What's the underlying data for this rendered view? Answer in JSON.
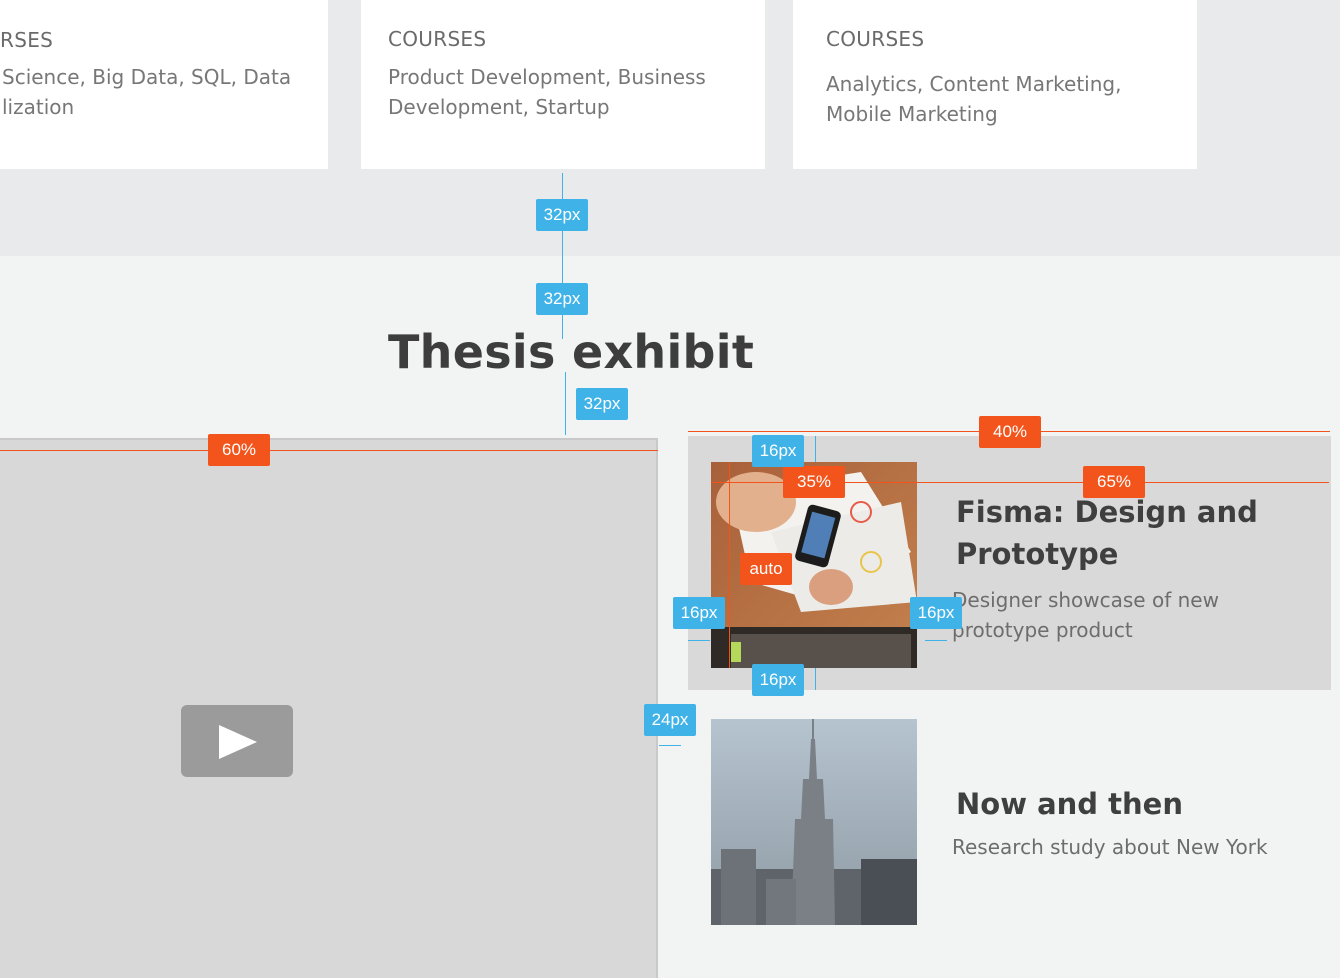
{
  "cards": [
    {
      "label": "RSES",
      "courses": "Science, Big Data, SQL, Data\nlization"
    },
    {
      "label": "COURSES",
      "courses": "Product Development, Business\nDevelopment, Startup"
    },
    {
      "label": "COURSES",
      "courses": "Analytics, Content Marketing,\nMobile Marketing"
    }
  ],
  "section": {
    "title": "Thesis exhibit"
  },
  "items": [
    {
      "title": "Fisma: Design and\nPrototype",
      "description": "Designer showcase of new\nprototype product"
    },
    {
      "title": "Now and then",
      "description": "Research study about New York"
    }
  ],
  "annotations": {
    "px32": "32px",
    "px16": "16px",
    "px24": "24px",
    "pct60": "60%",
    "pct40": "40%",
    "pct35": "35%",
    "pct65": "65%",
    "auto": "auto"
  },
  "colors": {
    "spacing": "#3fb3e8",
    "ratio": "#f2541b",
    "card": "#ffffff",
    "band": "#e9eaeb"
  },
  "icons": {
    "play": "play-icon"
  }
}
